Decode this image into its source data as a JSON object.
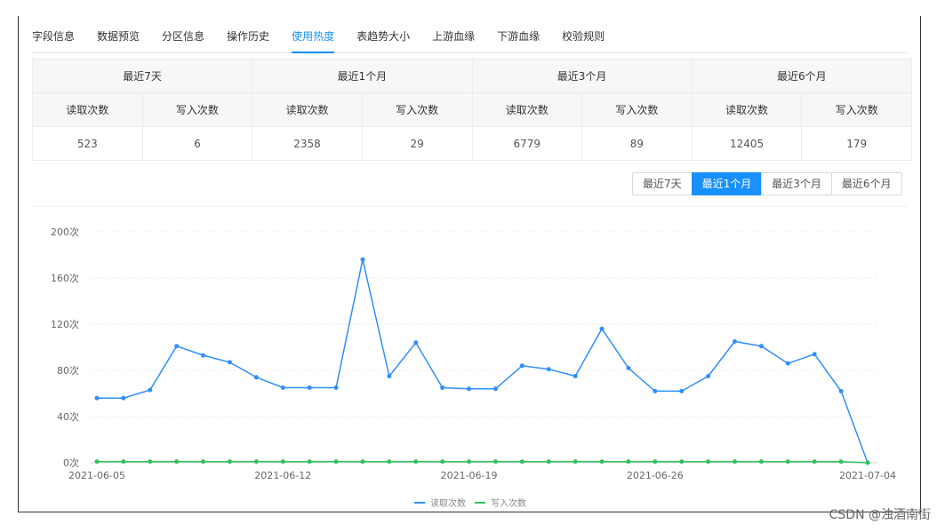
{
  "tabs": [
    {
      "label": "字段信息"
    },
    {
      "label": "数据预览"
    },
    {
      "label": "分区信息"
    },
    {
      "label": "操作历史"
    },
    {
      "label": "使用热度",
      "active": true
    },
    {
      "label": "表趋势大小"
    },
    {
      "label": "上游血缘"
    },
    {
      "label": "下游血缘"
    },
    {
      "label": "校验规则"
    }
  ],
  "stats": {
    "periods": [
      "最近7天",
      "最近1个月",
      "最近3个月",
      "最近6个月"
    ],
    "sub_headers": [
      "读取次数",
      "写入次数"
    ],
    "values": [
      [
        "523",
        "6"
      ],
      [
        "2358",
        "29"
      ],
      [
        "6779",
        "89"
      ],
      [
        "12405",
        "179"
      ]
    ]
  },
  "toggle": {
    "options": [
      "最近7天",
      "最近1个月",
      "最近3个月",
      "最近6个月"
    ],
    "selected": "最近1个月"
  },
  "colors": {
    "accent": "#1890ff",
    "read_series": "#2f8fff",
    "write_series": "#2fc25b"
  },
  "chart_data": {
    "type": "line",
    "x": [
      "2021-06-05",
      "2021-06-06",
      "2021-06-07",
      "2021-06-08",
      "2021-06-09",
      "2021-06-10",
      "2021-06-11",
      "2021-06-12",
      "2021-06-13",
      "2021-06-14",
      "2021-06-15",
      "2021-06-16",
      "2021-06-17",
      "2021-06-18",
      "2021-06-19",
      "2021-06-20",
      "2021-06-21",
      "2021-06-22",
      "2021-06-23",
      "2021-06-24",
      "2021-06-25",
      "2021-06-26",
      "2021-06-27",
      "2021-06-28",
      "2021-06-29",
      "2021-06-30",
      "2021-07-01",
      "2021-07-02",
      "2021-07-03",
      "2021-07-04"
    ],
    "x_tick_labels": [
      "2021-06-05",
      "2021-06-12",
      "2021-06-19",
      "2021-06-26",
      "2021-07-04"
    ],
    "x_tick_dates": [
      "2021-06-05",
      "2021-06-12",
      "2021-06-19",
      "2021-06-26",
      "2021-07-04"
    ],
    "y_tick_labels": [
      "0次",
      "40次",
      "80次",
      "120次",
      "160次",
      "200次"
    ],
    "ylim": [
      0,
      200
    ],
    "grid": true,
    "legend_position": "bottom",
    "series": [
      {
        "name": "读取次数",
        "values": [
          56,
          56,
          63,
          101,
          93,
          87,
          74,
          65,
          65,
          65,
          176,
          75,
          104,
          65,
          64,
          64,
          84,
          81,
          75,
          116,
          82,
          62,
          62,
          75,
          105,
          101,
          86,
          94,
          62,
          0
        ]
      },
      {
        "name": "写入次数",
        "values": [
          1,
          1,
          1,
          1,
          1,
          1,
          1,
          1,
          1,
          1,
          1,
          1,
          1,
          1,
          1,
          1,
          1,
          1,
          1,
          1,
          1,
          1,
          1,
          1,
          1,
          1,
          1,
          1,
          1,
          0
        ]
      }
    ]
  },
  "watermark": "CSDN @浊酒南街"
}
